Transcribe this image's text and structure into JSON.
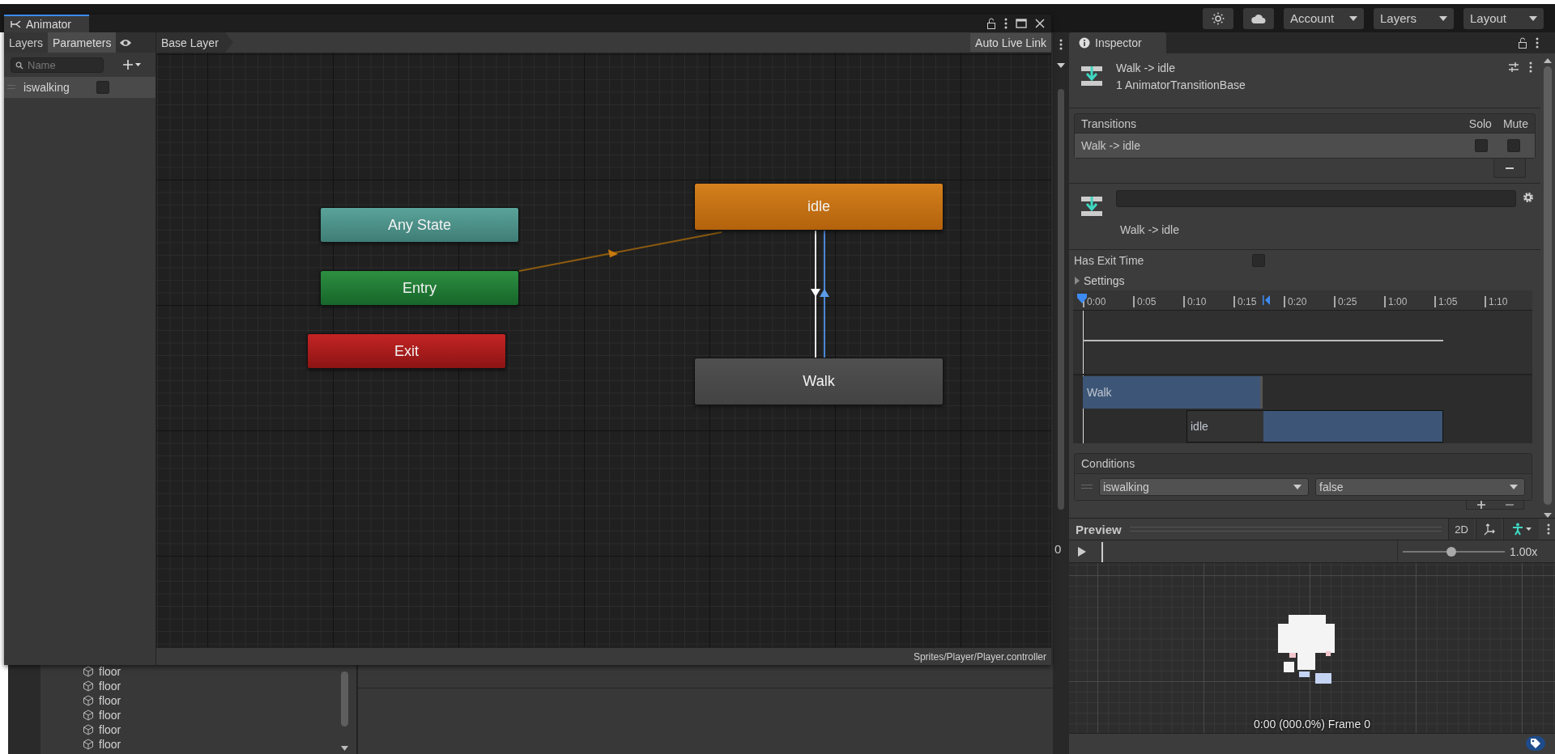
{
  "toolbar": {
    "dropdowns": [
      {
        "label": "Account"
      },
      {
        "label": "Layers"
      },
      {
        "label": "Layout"
      }
    ]
  },
  "animator": {
    "title": "Animator",
    "tabs": [
      {
        "label": "Layers",
        "selected": false
      },
      {
        "label": "Parameters",
        "selected": true
      }
    ],
    "breadcrumb": "Base Layer",
    "live_link_button": "Auto Live Link",
    "search": {
      "placeholder": "Name"
    },
    "parameters": [
      {
        "name": "iswalking",
        "checked": false
      }
    ],
    "states": [
      {
        "name": "Any State",
        "kind": "any"
      },
      {
        "name": "Entry",
        "kind": "entry"
      },
      {
        "name": "Exit",
        "kind": "exit"
      },
      {
        "name": "idle",
        "kind": "default"
      },
      {
        "name": "Walk",
        "kind": "normal"
      }
    ],
    "path": "Sprites/Player/Player.controller"
  },
  "side_panel": {
    "value": "0"
  },
  "hierarchy": {
    "items": [
      {
        "label": "floor"
      },
      {
        "label": "floor"
      },
      {
        "label": "floor"
      },
      {
        "label": "floor"
      },
      {
        "label": "floor"
      },
      {
        "label": "floor"
      }
    ]
  },
  "inspector": {
    "title": "Inspector",
    "object_name": "Walk -> idle",
    "object_type": "1 AnimatorTransitionBase",
    "transitions": {
      "header": "Transitions",
      "solo_label": "Solo",
      "mute_label": "Mute",
      "rows": [
        {
          "name": "Walk -> idle",
          "selected": true,
          "solo": false,
          "mute": false
        }
      ]
    },
    "transition_label": "Walk -> idle",
    "has_exit_time": {
      "label": "Has Exit Time",
      "checked": false
    },
    "settings": {
      "label": "Settings",
      "expanded": false
    },
    "timeline": {
      "ticks": [
        "0:00",
        "0:05",
        "0:10",
        "0:15",
        "0:20",
        "0:25",
        "1:00",
        "1:05",
        "1:10"
      ],
      "tracks": [
        {
          "label": "Walk"
        },
        {
          "label": "idle"
        }
      ]
    },
    "conditions": {
      "header": "Conditions",
      "rows": [
        {
          "parameter": "iswalking",
          "value": "false"
        }
      ]
    },
    "preview": {
      "title": "Preview",
      "mode_button": "2D",
      "speed": "1.00x",
      "speed_slider": {
        "level": 0.48
      },
      "frame": "0:00 (000.0%) Frame 0"
    }
  }
}
